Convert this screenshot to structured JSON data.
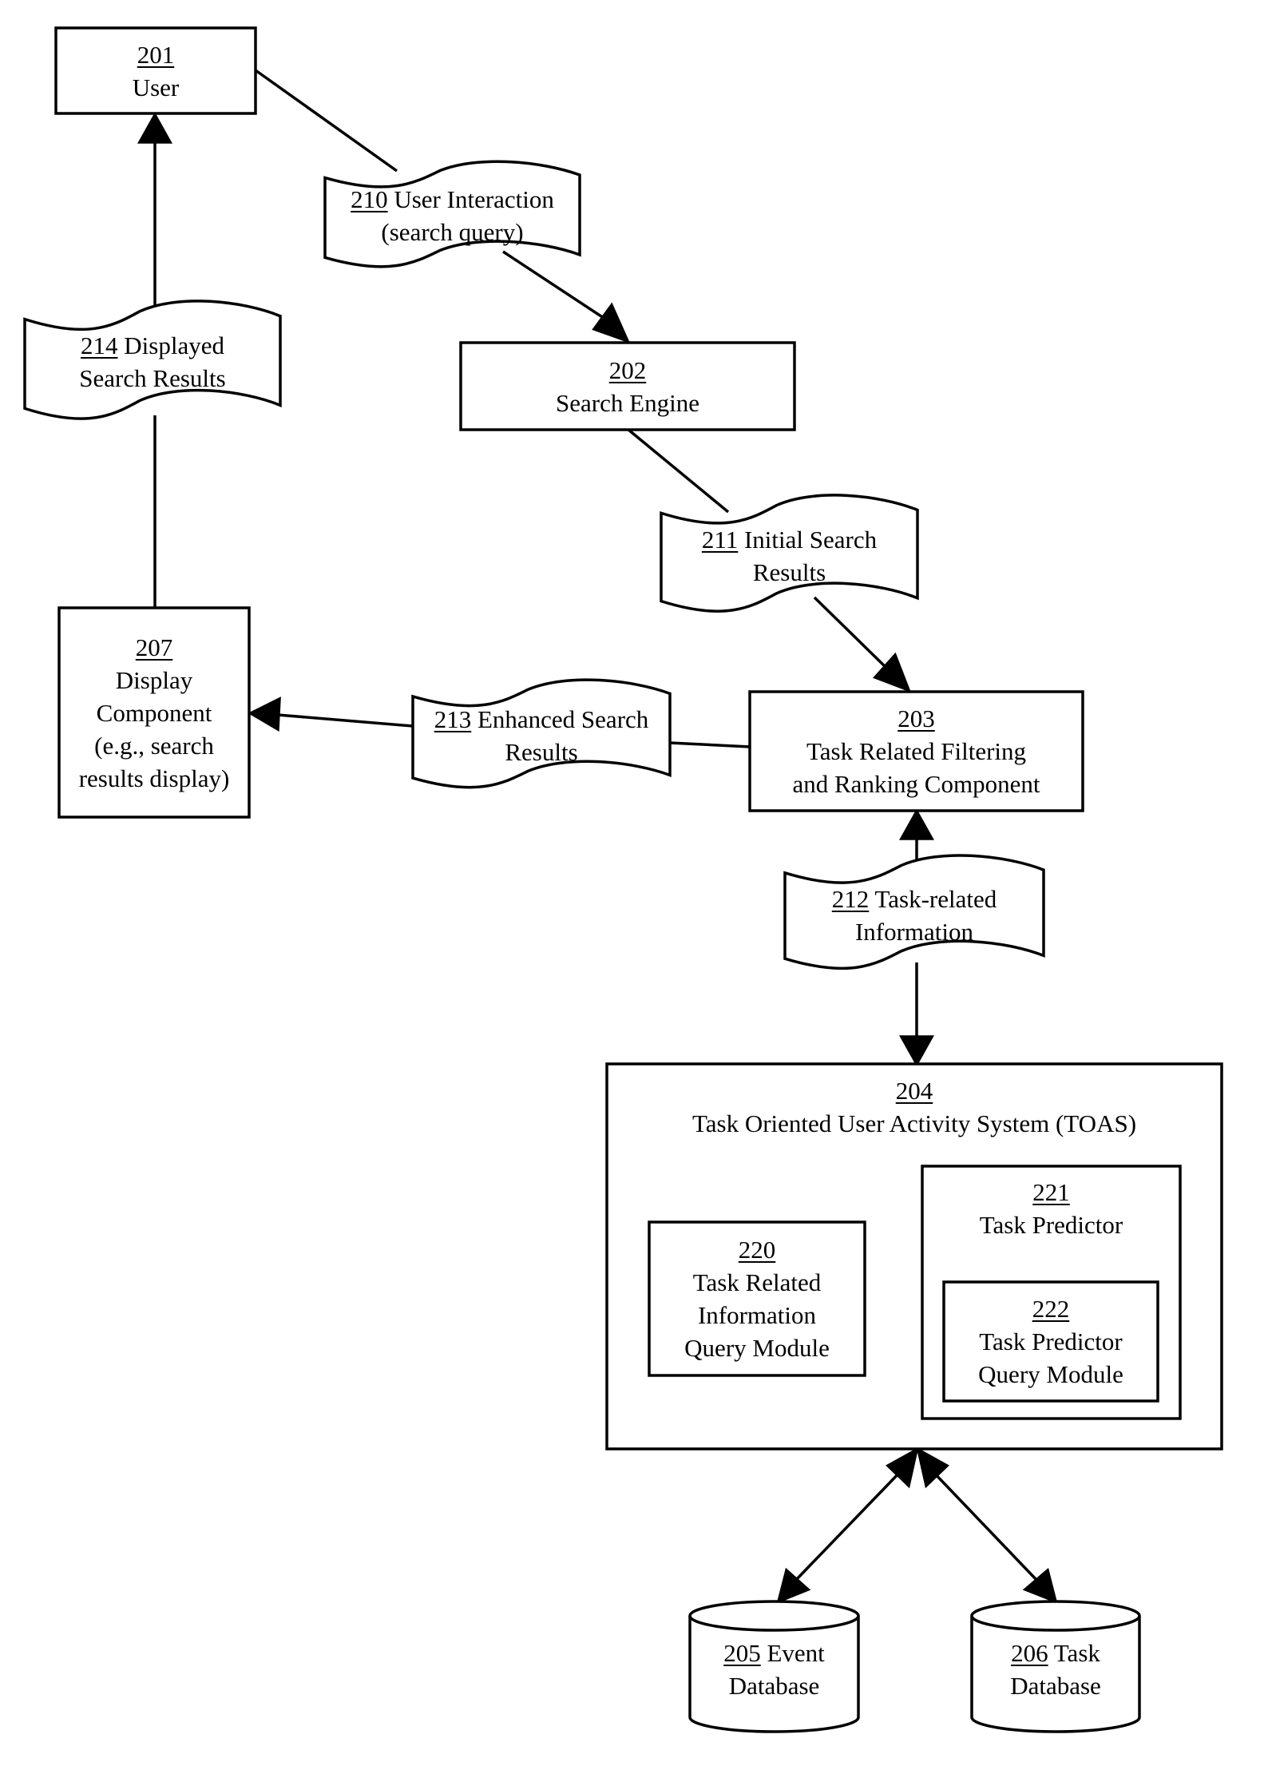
{
  "diagram": {
    "nodes": {
      "user": {
        "number": "201",
        "lines": [
          "User"
        ]
      },
      "user_interaction": {
        "number": "210",
        "first_line_rest": " User Interaction",
        "lines": [
          "(search query)"
        ]
      },
      "displayed_results": {
        "number": "214",
        "first_line_rest": " Displayed",
        "lines": [
          "Search Results"
        ]
      },
      "search_engine": {
        "number": "202",
        "lines": [
          "Search Engine"
        ]
      },
      "initial_results": {
        "number": "211",
        "first_line_rest": " Initial Search",
        "lines": [
          "Results"
        ]
      },
      "display_component": {
        "number": "207",
        "lines": [
          "Display",
          "Component",
          "(e.g., search",
          "results display)"
        ]
      },
      "enhanced_results": {
        "number": "213",
        "first_line_rest": " Enhanced Search",
        "lines": [
          "Results"
        ]
      },
      "filtering_component": {
        "number": "203",
        "lines": [
          "Task Related Filtering",
          "and Ranking Component"
        ]
      },
      "task_related_info": {
        "number": "212",
        "first_line_rest": " Task-related",
        "lines": [
          "Information"
        ]
      },
      "toas": {
        "number": "204",
        "lines": [
          "Task Oriented User Activity System (TOAS)"
        ]
      },
      "info_query_module": {
        "number": "220",
        "lines": [
          "Task Related",
          "Information",
          "Query Module"
        ]
      },
      "task_predictor": {
        "number": "221",
        "lines": [
          "Task Predictor"
        ]
      },
      "predictor_query_module": {
        "number": "222",
        "lines": [
          "Task Predictor",
          "Query Module"
        ]
      },
      "event_db": {
        "number": "205",
        "first_line_rest": " Event",
        "lines": [
          "Database"
        ]
      },
      "task_db": {
        "number": "206",
        "first_line_rest": " Task",
        "lines": [
          "Database"
        ]
      }
    },
    "edges": [
      {
        "from": "201",
        "to": "210",
        "arrow": "none"
      },
      {
        "from": "210",
        "to": "202",
        "arrow": "end"
      },
      {
        "from": "202",
        "to": "211",
        "arrow": "none"
      },
      {
        "from": "211",
        "to": "203",
        "arrow": "end"
      },
      {
        "from": "203",
        "to": "213",
        "arrow": "none"
      },
      {
        "from": "213",
        "to": "207",
        "arrow": "end"
      },
      {
        "from": "207",
        "to": "214",
        "arrow": "none"
      },
      {
        "from": "214",
        "to": "201",
        "arrow": "end"
      },
      {
        "from": "212",
        "to": "203",
        "arrow": "end"
      },
      {
        "from": "212",
        "to": "204",
        "arrow": "end"
      },
      {
        "from": "204",
        "to": "205",
        "arrow": "both"
      },
      {
        "from": "204",
        "to": "206",
        "arrow": "both"
      }
    ]
  }
}
